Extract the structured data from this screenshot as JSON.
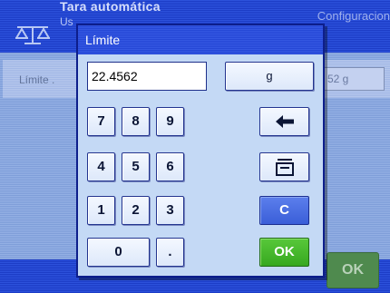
{
  "background": {
    "title": "Tara automática",
    "subtitle": "Us",
    "config_label": "Configuracion",
    "row_label": "Límite",
    "row_label_suffix": ".",
    "row_value": "52 g",
    "ok_label": "OK"
  },
  "dialog": {
    "title": "Límite",
    "input_value": "22.4562",
    "unit_button": "g",
    "keys": {
      "k7": "7",
      "k8": "8",
      "k9": "9",
      "k4": "4",
      "k5": "5",
      "k6": "6",
      "k1": "1",
      "k2": "2",
      "k3": "3",
      "k0": "0",
      "dot": ".",
      "clear": "C",
      "ok": "OK"
    },
    "backspace_icon": "arrow-left-icon",
    "tare_icon": "scale-tare-icon"
  }
}
